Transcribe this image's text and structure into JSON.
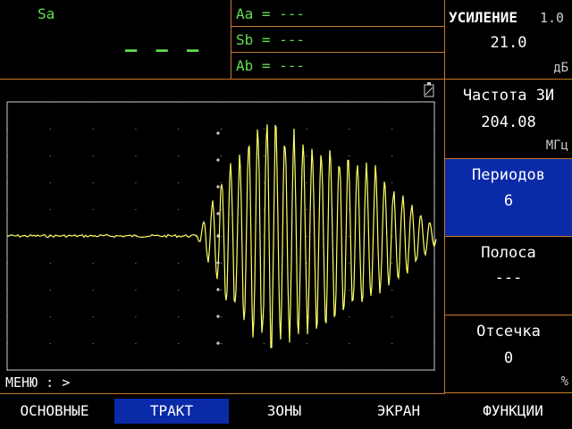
{
  "readout": {
    "sa_label": "Sa",
    "sa_value": "— — —",
    "aa": "Aa = ---",
    "sb": "Sb = ---",
    "ab": "Ab = ---"
  },
  "gain": {
    "title": "УСИЛЕНИЕ",
    "step": "1.0",
    "value": "21.0",
    "unit": "дБ"
  },
  "side": {
    "freq_title": "Частота ЗИ",
    "freq_value": "204.08",
    "freq_unit": "МГц",
    "periods_title": "Периодов",
    "periods_value": "6",
    "band_title": "Полоса",
    "band_value": "---",
    "cutoff_title": "Отсечка",
    "cutoff_value": "0",
    "percent": "%"
  },
  "screen": {
    "menu_path": "МЕНЮ : >",
    "battery_icon": "battery-icon"
  },
  "menu": {
    "items": [
      "ОСНОВНЫЕ",
      "ТРАКТ",
      "ЗОНЫ",
      "ЭКРАН",
      "ФУНКЦИИ"
    ],
    "active_index": 1
  },
  "colors": {
    "border": "#c87a2a",
    "trace": "#ffff66",
    "readout": "#66dd55",
    "highlight": "#0a2aa8"
  }
}
